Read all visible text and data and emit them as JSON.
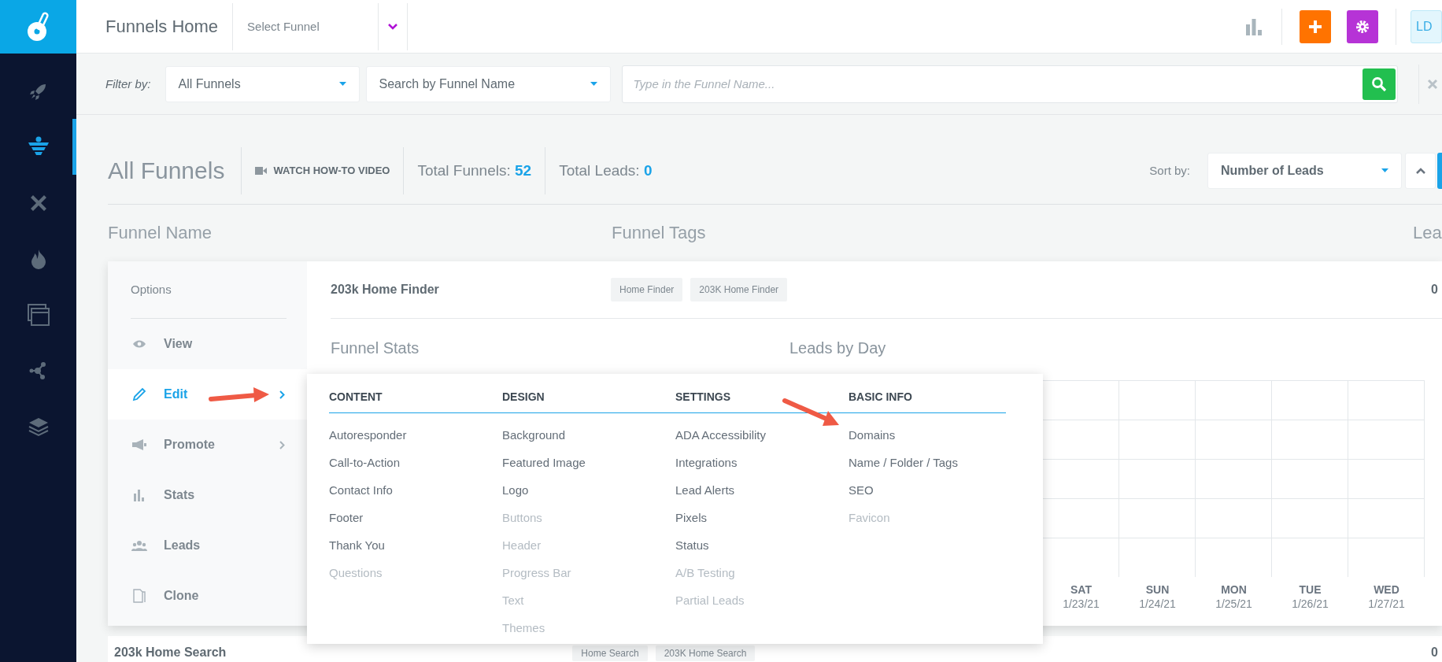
{
  "header": {
    "title": "Funnels Home",
    "funnel_select": {
      "placeholder": "Select Funnel"
    },
    "user_initials": "LD"
  },
  "sidebar": {
    "items": [
      {
        "selected": false
      },
      {
        "selected": true
      },
      {
        "selected": false
      },
      {
        "selected": false
      },
      {
        "selected": false
      },
      {
        "selected": false
      },
      {
        "selected": false
      }
    ]
  },
  "filter_bar": {
    "label": "Filter by:",
    "funnel_filter": "All Funnels",
    "search_mode": "Search by Funnel Name",
    "search": {
      "placeholder": "Type in the Funnel Name..."
    }
  },
  "summary": {
    "title": "All Funnels",
    "video_link": "WATCH HOW-TO VIDEO",
    "total_funnels_label": "Total Funnels:",
    "total_funnels": "52",
    "total_leads_label": "Total Leads:",
    "total_leads": "0",
    "sort_label": "Sort by:",
    "sort_value": "Number of Leads"
  },
  "columns": [
    "Funnel Name",
    "Funnel Tags",
    "Lea"
  ],
  "funnels": [
    {
      "name": "203k Home Finder",
      "tags": [
        "Home Finder",
        "203K Home Finder"
      ],
      "leads": "0",
      "expanded": true
    },
    {
      "name": "203k Home Search",
      "tags": [
        "Home Search",
        "203K Home Search"
      ],
      "leads": "0",
      "expanded": false
    }
  ],
  "options": {
    "title": "Options",
    "items": [
      {
        "label": "View",
        "selected": false,
        "submenu": false
      },
      {
        "label": "Edit",
        "selected": true,
        "submenu": true
      },
      {
        "label": "Promote",
        "selected": false,
        "submenu": true
      },
      {
        "label": "Stats",
        "selected": false,
        "submenu": false
      },
      {
        "label": "Leads",
        "selected": false,
        "submenu": false
      },
      {
        "label": "Clone",
        "selected": false,
        "submenu": false
      }
    ]
  },
  "edit_menu": {
    "columns": [
      {
        "heading": "CONTENT",
        "items": [
          {
            "label": "Autoresponder",
            "disabled": false
          },
          {
            "label": "Call-to-Action",
            "disabled": false
          },
          {
            "label": "Contact Info",
            "disabled": false
          },
          {
            "label": "Footer",
            "disabled": false
          },
          {
            "label": "Thank You",
            "disabled": false
          },
          {
            "label": "Questions",
            "disabled": true
          }
        ]
      },
      {
        "heading": "DESIGN",
        "items": [
          {
            "label": "Background",
            "disabled": false
          },
          {
            "label": "Featured Image",
            "disabled": false
          },
          {
            "label": "Logo",
            "disabled": false
          },
          {
            "label": "Buttons",
            "disabled": true
          },
          {
            "label": "Header",
            "disabled": true
          },
          {
            "label": "Progress Bar",
            "disabled": true
          },
          {
            "label": "Text",
            "disabled": true
          },
          {
            "label": "Themes",
            "disabled": true
          }
        ]
      },
      {
        "heading": "SETTINGS",
        "items": [
          {
            "label": "ADA Accessibility",
            "disabled": false
          },
          {
            "label": "Integrations",
            "disabled": false
          },
          {
            "label": "Lead Alerts",
            "disabled": false
          },
          {
            "label": "Pixels",
            "disabled": false
          },
          {
            "label": "Status",
            "disabled": false
          },
          {
            "label": "A/B Testing",
            "disabled": true
          },
          {
            "label": "Partial Leads",
            "disabled": true
          }
        ]
      },
      {
        "heading": "BASIC INFO",
        "items": [
          {
            "label": "Domains",
            "disabled": false
          },
          {
            "label": "Name / Folder / Tags",
            "disabled": false
          },
          {
            "label": "SEO",
            "disabled": false
          },
          {
            "label": "Favicon",
            "disabled": true
          }
        ]
      }
    ]
  },
  "funnel_stats": {
    "title": "Funnel Stats"
  },
  "leads_by_day": {
    "title": "Leads by Day",
    "days": [
      {
        "day": "SAT",
        "date": "1/23/21"
      },
      {
        "day": "SUN",
        "date": "1/24/21"
      },
      {
        "day": "MON",
        "date": "1/25/21"
      },
      {
        "day": "TUE",
        "date": "1/26/21"
      },
      {
        "day": "WED",
        "date": "1/27/21"
      }
    ]
  }
}
